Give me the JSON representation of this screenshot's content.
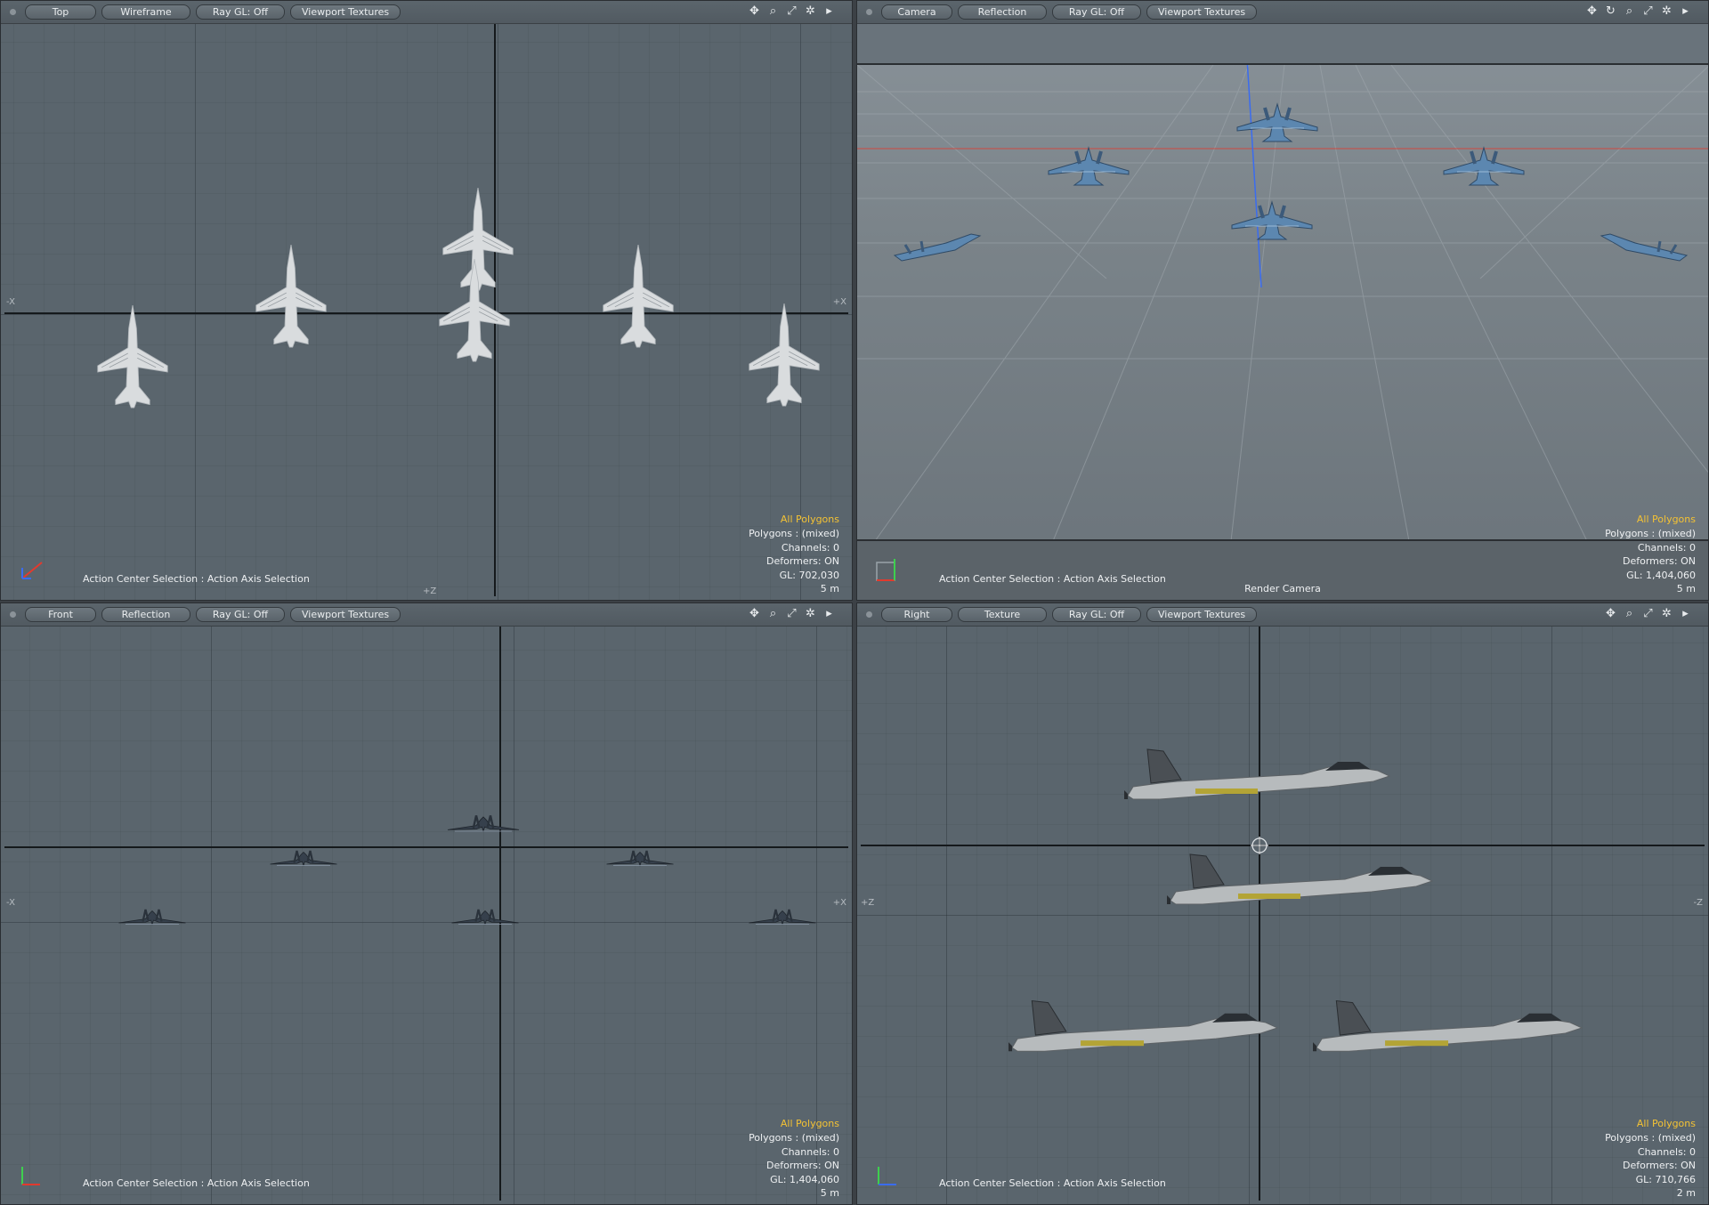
{
  "viewports": {
    "top_left": {
      "view": "Top",
      "shading": "Wireframe",
      "raygl": "Ray GL: Off",
      "textures": "Viewport Textures",
      "axis_left": "-X",
      "axis_right": "+X",
      "axis_bottom": "+Z",
      "info": {
        "selection": "All Polygons",
        "polygons": "Polygons : (mixed)",
        "channels": "Channels: 0",
        "deformers": "Deformers: ON",
        "gl": "GL: 702,030",
        "scale": "5 m"
      },
      "status": "Action Center Selection : Action Axis Selection"
    },
    "top_right": {
      "view": "Camera",
      "shading": "Reflection",
      "raygl": "Ray GL: Off",
      "textures": "Viewport Textures",
      "info": {
        "selection": "All Polygons",
        "polygons": "Polygons : (mixed)",
        "channels": "Channels: 0",
        "deformers": "Deformers: ON",
        "gl": "GL: 1,404,060",
        "scale": "5 m"
      },
      "status": "Action Center Selection : Action Axis Selection",
      "camera_label": "Render Camera"
    },
    "bottom_left": {
      "view": "Front",
      "shading": "Reflection",
      "raygl": "Ray GL: Off",
      "textures": "Viewport Textures",
      "axis_left": "-X",
      "axis_right": "+X",
      "info": {
        "selection": "All Polygons",
        "polygons": "Polygons : (mixed)",
        "channels": "Channels: 0",
        "deformers": "Deformers: ON",
        "gl": "GL: 1,404,060",
        "scale": "5 m"
      },
      "status": "Action Center Selection : Action Axis Selection"
    },
    "bottom_right": {
      "view": "Right",
      "shading": "Texture",
      "raygl": "Ray GL: Off",
      "textures": "Viewport Textures",
      "axis_left": "+Z",
      "axis_right": "-Z",
      "info": {
        "selection": "All Polygons",
        "polygons": "Polygons : (mixed)",
        "channels": "Channels: 0",
        "deformers": "Deformers: ON",
        "gl": "GL: 710,766",
        "scale": "2 m"
      },
      "status": "Action Center Selection : Action Axis Selection"
    }
  },
  "icons": [
    "move-view-icon",
    "rotate-view-icon",
    "zoom-view-icon",
    "maximize-icon",
    "settings-icon",
    "expand-arrow-icon"
  ],
  "colors": {
    "selection_highlight": "#f4c234",
    "viewport_bg": "#5a656d",
    "axis_x": "#e23a2e",
    "axis_y": "#3ecf4e",
    "axis_z": "#3a6cf0"
  }
}
